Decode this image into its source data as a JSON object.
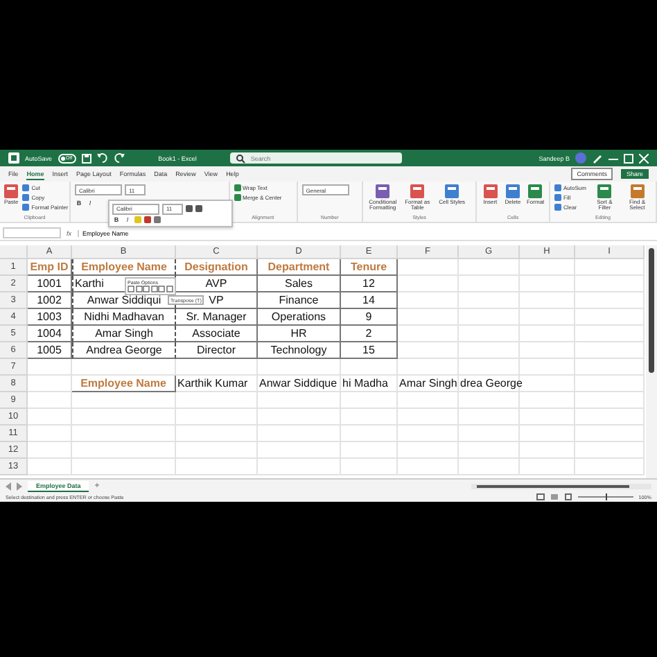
{
  "title_bar": {
    "autosave_label": "AutoSave",
    "autosave": {
      "label": "Off",
      "on": false
    },
    "title": "Book1 - Excel",
    "search": {
      "placeholder": "Search"
    },
    "user": "Sandeep B"
  },
  "menu": {
    "tabs": [
      {
        "label": "File",
        "selected": false
      },
      {
        "label": "Home",
        "selected": true
      },
      {
        "label": "Insert",
        "selected": false
      },
      {
        "label": "Page Layout",
        "selected": false
      },
      {
        "label": "Formulas",
        "selected": false
      },
      {
        "label": "Data",
        "selected": false
      },
      {
        "label": "Review",
        "selected": false
      },
      {
        "label": "View",
        "selected": false
      },
      {
        "label": "Help",
        "selected": false
      }
    ],
    "comments": "Comments",
    "share": "Share"
  },
  "ribbon": {
    "groups": [
      {
        "label": "Clipboard",
        "items": [
          {
            "kind": "large",
            "label": "Paste"
          },
          {
            "kind": "stack",
            "labels": [
              "Cut",
              "Copy",
              "Format Painter"
            ]
          }
        ]
      },
      {
        "items": [
          {
            "kind": "fields",
            "fields": [
              "Calibri",
              "11"
            ],
            "buttons": [
              "B",
              "I"
            ]
          }
        ]
      },
      {
        "label": "Alignment",
        "items": [
          {
            "kind": "stack",
            "labels": [
              "Wrap Text",
              "Merge & Center"
            ]
          }
        ]
      },
      {
        "label": "Number",
        "items": [
          {
            "kind": "fields",
            "fields": [
              "General"
            ]
          }
        ]
      },
      {
        "label": "Styles",
        "items": [
          {
            "kind": "large",
            "label": "Conditional Formatting"
          },
          {
            "kind": "large",
            "label": "Format as Table"
          },
          {
            "kind": "large",
            "label": "Cell Styles"
          }
        ]
      },
      {
        "label": "Cells",
        "items": [
          {
            "kind": "large",
            "label": "Insert"
          },
          {
            "kind": "large",
            "label": "Delete"
          },
          {
            "kind": "large",
            "label": "Format"
          }
        ]
      },
      {
        "label": "Editing",
        "items": [
          {
            "kind": "stack",
            "labels": [
              "AutoSum",
              "Fill",
              "Clear"
            ]
          },
          {
            "kind": "large",
            "label": "Sort & Filter"
          },
          {
            "kind": "large",
            "label": "Find & Select"
          }
        ]
      }
    ]
  },
  "mini_toolbar": {
    "font": "Calibri",
    "size": "11",
    "buttons": [
      "B",
      "I"
    ]
  },
  "formula_bar": {
    "function_label": "fx",
    "value": "Employee Name"
  },
  "grid": {
    "columns": [
      "A",
      "B",
      "C",
      "D",
      "E",
      "F",
      "G",
      "H",
      "I"
    ],
    "rows": [
      {
        "number": "1",
        "cells": [
          {
            "text": "Emp ID",
            "kind": "header",
            "copied": false
          },
          {
            "text": "Employee Name",
            "kind": "header",
            "copied": true
          },
          {
            "text": "Designation",
            "kind": "header",
            "copied": false
          },
          {
            "text": "Department",
            "kind": "header",
            "copied": false
          },
          {
            "text": "Tenure",
            "kind": "header",
            "copied": false
          }
        ]
      },
      {
        "number": "2",
        "cells": [
          {
            "text": "1001",
            "kind": "data",
            "copied": false
          },
          {
            "text": "Karthi",
            "kind": "covered",
            "copied": true
          },
          {
            "text": "AVP",
            "kind": "data",
            "copied": false
          },
          {
            "text": "Sales",
            "kind": "data",
            "copied": false
          },
          {
            "text": "12",
            "kind": "data",
            "copied": false
          }
        ]
      },
      {
        "number": "3",
        "cells": [
          {
            "text": "1002",
            "kind": "data",
            "copied": false
          },
          {
            "text": "Anwar Siddiqui",
            "kind": "data",
            "copied": true
          },
          {
            "text": "VP",
            "kind": "data",
            "copied": false
          },
          {
            "text": "Finance",
            "kind": "data",
            "copied": false
          },
          {
            "text": "14",
            "kind": "data",
            "copied": false
          }
        ]
      },
      {
        "number": "4",
        "cells": [
          {
            "text": "1003",
            "kind": "data",
            "copied": false
          },
          {
            "text": "Nidhi Madhavan",
            "kind": "data",
            "copied": true
          },
          {
            "text": "Sr. Manager",
            "kind": "data",
            "copied": false
          },
          {
            "text": "Operations",
            "kind": "data",
            "copied": false
          },
          {
            "text": "9",
            "kind": "data",
            "copied": false
          }
        ]
      },
      {
        "number": "5",
        "cells": [
          {
            "text": "1004",
            "kind": "data",
            "copied": false
          },
          {
            "text": "Amar Singh",
            "kind": "data",
            "copied": true
          },
          {
            "text": "Associate",
            "kind": "data",
            "copied": false
          },
          {
            "text": "HR",
            "kind": "data",
            "copied": false
          },
          {
            "text": "2",
            "kind": "data",
            "copied": false
          }
        ]
      },
      {
        "number": "6",
        "cells": [
          {
            "text": "1005",
            "kind": "data",
            "copied": false
          },
          {
            "text": "Andrea George",
            "kind": "data",
            "copied": true
          },
          {
            "text": "Director",
            "kind": "data",
            "copied": false
          },
          {
            "text": "Technology",
            "kind": "data",
            "copied": false
          },
          {
            "text": "15",
            "kind": "data",
            "copied": false
          }
        ]
      },
      {
        "number": "7"
      },
      {
        "number": "8",
        "cells": [
          null,
          {
            "text": "Employee Name",
            "kind": "header",
            "copied": false
          },
          {
            "text": "Karthik Kumar",
            "kind": "pasted",
            "copied": false
          },
          {
            "text": "Anwar Siddique",
            "kind": "pasted",
            "copied": false
          },
          {
            "text": "hi Madha",
            "kind": "pasted",
            "copied": false
          },
          {
            "text": "Amar Singh",
            "kind": "pasted",
            "copied": false
          },
          {
            "text": "drea George",
            "kind": "pasted",
            "copied": false
          }
        ]
      },
      {
        "number": "9"
      },
      {
        "number": "10"
      },
      {
        "number": "11"
      },
      {
        "number": "12"
      },
      {
        "number": "13"
      }
    ]
  },
  "paste_options": {
    "title": "Paste Options",
    "tooltip": "Transpose (T)"
  },
  "sheet_tabs": [
    {
      "label": "Employee Data",
      "selected": true
    }
  ],
  "add_sheet": "+",
  "status_bar": {
    "message": "Select destination and press ENTER or choose Paste",
    "zoom": {
      "level": 0.5
    },
    "zoom_label": "100%"
  }
}
